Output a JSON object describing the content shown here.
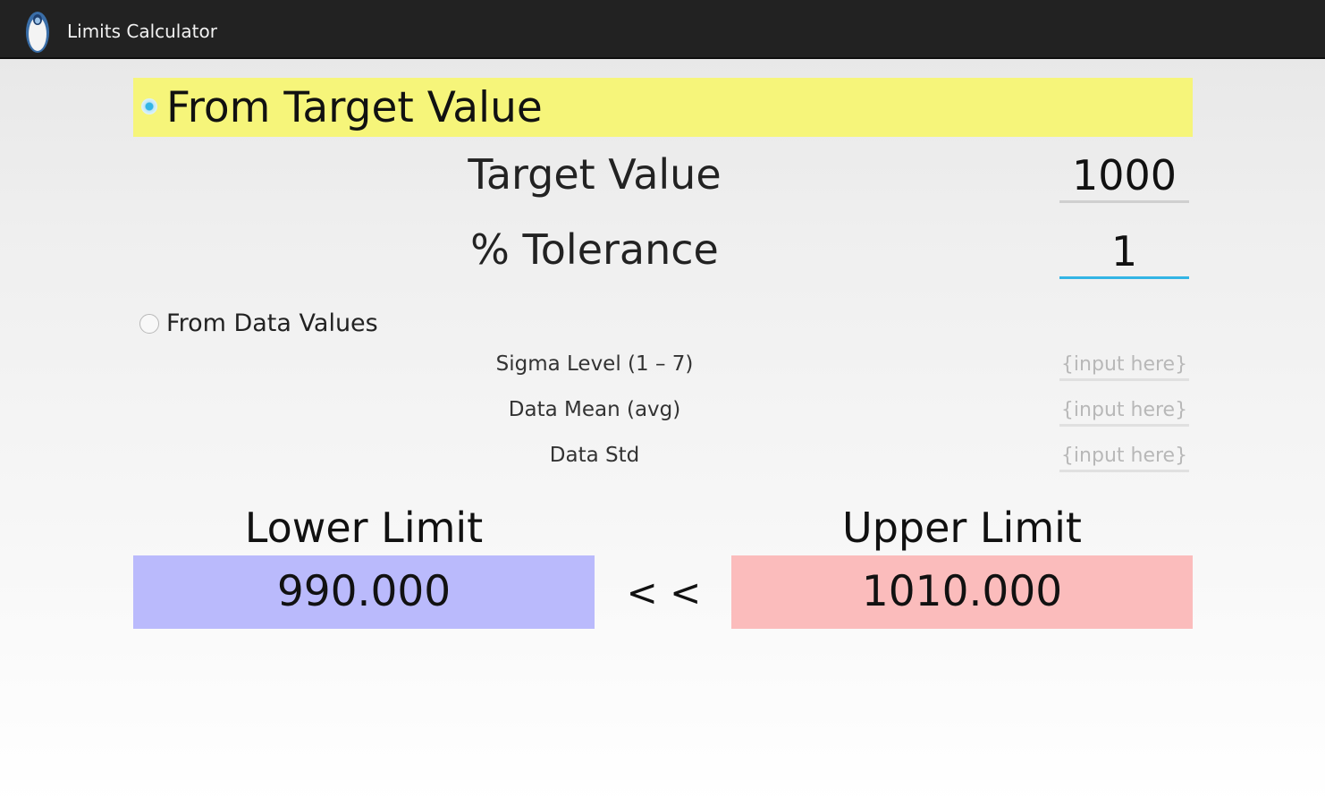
{
  "actionbar": {
    "title": "Limits Calculator",
    "icon": "app-logo-icon"
  },
  "target_section": {
    "label": "From Target Value",
    "selected": true,
    "highlight_color": "#f6f57a",
    "target_value": {
      "label": "Target Value",
      "value": "1000"
    },
    "tolerance": {
      "label": "% Tolerance",
      "value": "1"
    }
  },
  "data_section": {
    "label": "From Data Values",
    "selected": false,
    "sigma_level": {
      "label": "Sigma Level (1 – 7)",
      "placeholder": "{input here}"
    },
    "data_mean": {
      "label": "Data Mean (avg)",
      "placeholder": "{input here}"
    },
    "data_std": {
      "label": "Data Std",
      "placeholder": "{input here}"
    }
  },
  "results": {
    "lower_label": "Lower Limit",
    "lower_value": "990.000",
    "separator": "< <",
    "upper_label": "Upper Limit",
    "upper_value": "1010.000",
    "lower_color": "#babafc",
    "upper_color": "#fbbcbc"
  },
  "colors": {
    "accent": "#33b5e5",
    "actionbar": "#222222"
  }
}
